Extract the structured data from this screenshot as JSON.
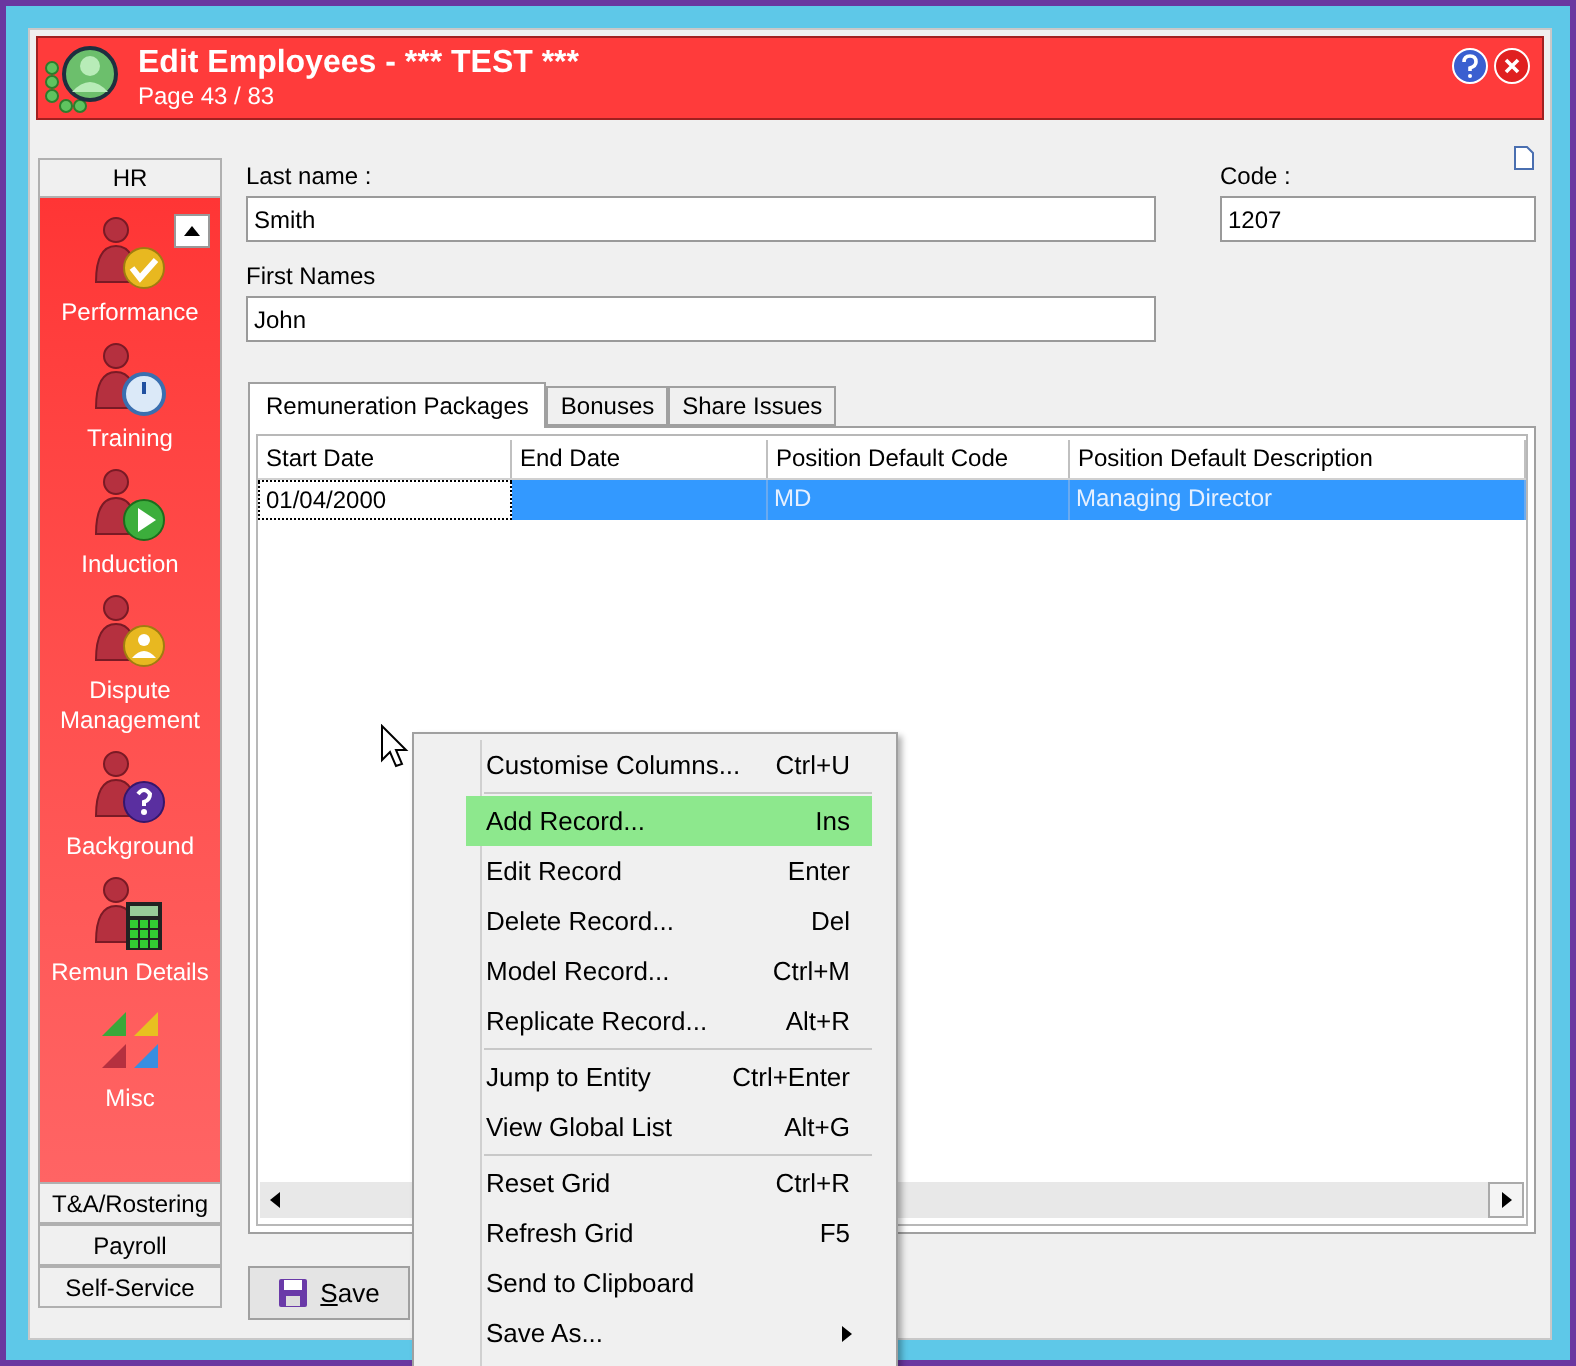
{
  "window": {
    "title": "Edit Employees - *** TEST ***",
    "subtitle": "Page 43 / 83"
  },
  "sidebar": {
    "header": "HR",
    "items": [
      {
        "label": "Performance"
      },
      {
        "label": "Training"
      },
      {
        "label": "Induction"
      },
      {
        "label": "Dispute Management"
      },
      {
        "label": "Background"
      },
      {
        "label": "Remun Details"
      },
      {
        "label": "Misc"
      }
    ],
    "sections": [
      "T&A/Rostering",
      "Payroll",
      "Self-Service"
    ]
  },
  "form": {
    "last_name": {
      "label": "Last name :",
      "value": "Smith"
    },
    "code": {
      "label": "Code :",
      "value": "1207"
    },
    "first_names": {
      "label": "First Names",
      "value": "John"
    }
  },
  "tabs": [
    {
      "label": "Remuneration Packages",
      "selected": true
    },
    {
      "label": "Bonuses",
      "selected": false
    },
    {
      "label": "Share Issues",
      "selected": false
    }
  ],
  "grid": {
    "columns": [
      "Start Date",
      "End Date",
      "Position Default Code",
      "Position Default Description"
    ],
    "rows": [
      {
        "cells": [
          "01/04/2000",
          "",
          "MD",
          "Managing Director"
        ],
        "selected": true
      }
    ]
  },
  "save_button": "Save",
  "context_menu": {
    "items": [
      {
        "kind": "item",
        "label": "Customise Columns...",
        "shortcut": "Ctrl+U",
        "selected": false
      },
      {
        "kind": "separator"
      },
      {
        "kind": "item",
        "label": "Add Record...",
        "shortcut": "Ins",
        "selected": true
      },
      {
        "kind": "item",
        "label": "Edit Record",
        "shortcut": "Enter",
        "selected": false
      },
      {
        "kind": "item",
        "label": "Delete Record...",
        "shortcut": "Del",
        "selected": false
      },
      {
        "kind": "item",
        "label": "Model Record...",
        "shortcut": "Ctrl+M",
        "selected": false
      },
      {
        "kind": "item",
        "label": "Replicate Record...",
        "shortcut": "Alt+R",
        "selected": false
      },
      {
        "kind": "separator"
      },
      {
        "kind": "item",
        "label": "Jump to Entity",
        "shortcut": "Ctrl+Enter",
        "selected": false
      },
      {
        "kind": "item",
        "label": "View Global List",
        "shortcut": "Alt+G",
        "selected": false
      },
      {
        "kind": "separator"
      },
      {
        "kind": "item",
        "label": "Reset Grid",
        "shortcut": "Ctrl+R",
        "selected": false
      },
      {
        "kind": "item",
        "label": "Refresh Grid",
        "shortcut": "F5",
        "selected": false
      },
      {
        "kind": "item",
        "label": "Send to Clipboard",
        "selected": false
      },
      {
        "kind": "item",
        "label": "Save As...",
        "submenu": true,
        "selected": false
      }
    ]
  }
}
